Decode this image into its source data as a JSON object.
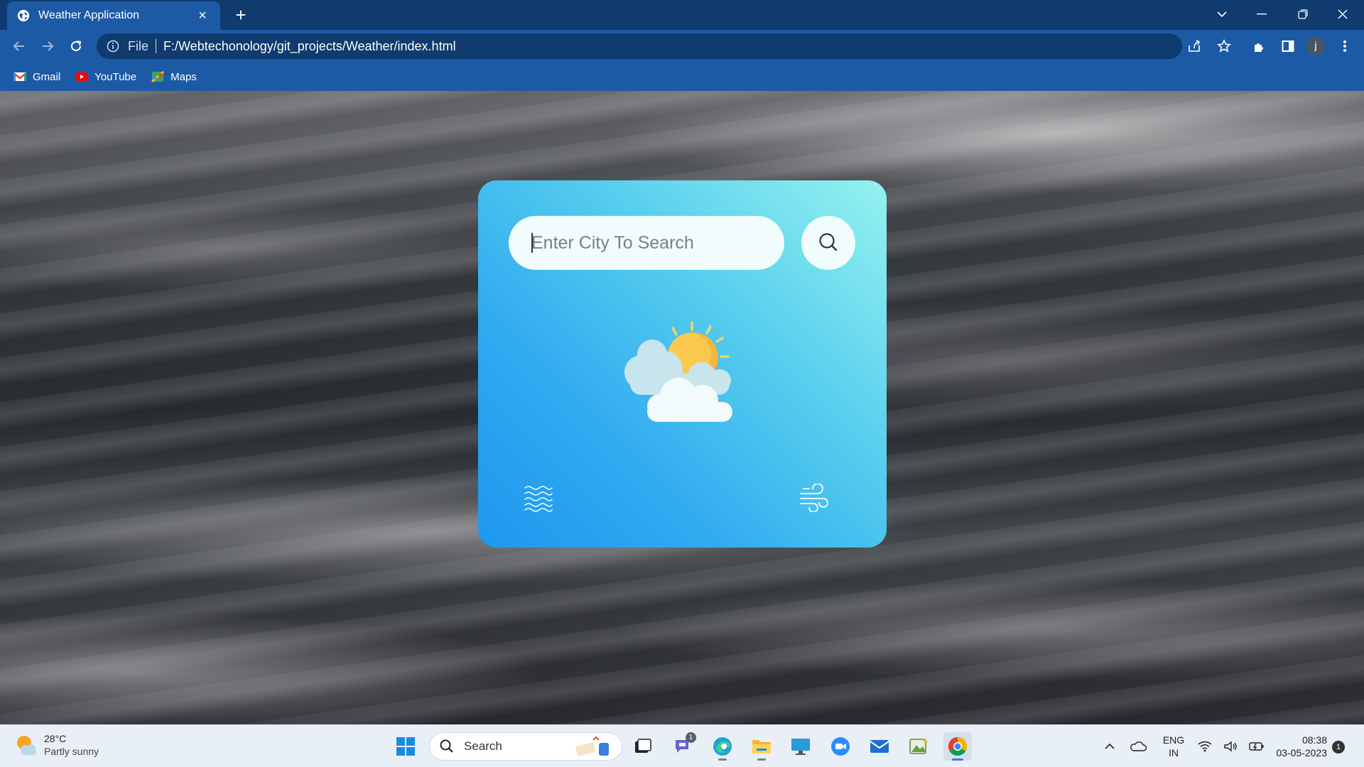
{
  "browser": {
    "tab_title": "Weather Application",
    "tab_close": "×",
    "new_tab": "+",
    "address_scheme": "File",
    "address_url": "F:/Webtechonology/git_projects/Weather/index.html",
    "profile_initial": "j",
    "bookmarks": [
      {
        "label": "Gmail",
        "icon": "gmail-icon"
      },
      {
        "label": "YouTube",
        "icon": "youtube-icon"
      },
      {
        "label": "Maps",
        "icon": "maps-icon"
      }
    ]
  },
  "weather_app": {
    "search_placeholder": "Enter City To Search",
    "search_value": "",
    "icons": {
      "search": "search-icon",
      "weather": "partly-sunny-icon",
      "humidity": "humidity-waves-icon",
      "wind": "wind-icon"
    },
    "colors": {
      "card_gradient_start": "#1e98ee",
      "card_gradient_end": "#95f2ef",
      "input_bg": "#f0fdfc"
    }
  },
  "taskbar": {
    "weather_temp": "28°C",
    "weather_condition": "Partly sunny",
    "search_label": "Search",
    "chat_badge": "1",
    "language": "ENG",
    "region": "IN",
    "time": "08:38",
    "date": "03-05-2023",
    "notification_count": "1"
  }
}
